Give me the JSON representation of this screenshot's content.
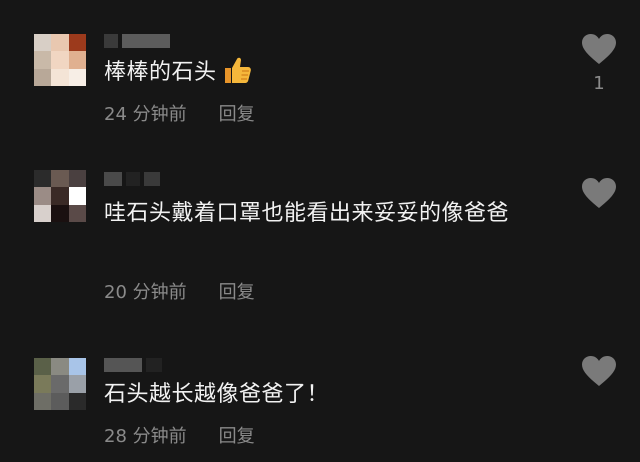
{
  "comments": [
    {
      "text": "棒棒的石头",
      "emoji": "thumbs-up-icon",
      "time": "24 分钟前",
      "reply_label": "回复",
      "likes": "1"
    },
    {
      "text": "哇石头戴着口罩也能看出来妥妥的像爸爸",
      "time": "20 分钟前",
      "reply_label": "回复"
    },
    {
      "text": "石头越长越像爸爸了！",
      "time": "28 分钟前",
      "reply_label": "回复"
    }
  ],
  "colors": {
    "background": "#161616",
    "text": "#f2f2f2",
    "muted": "#8a8a8a",
    "heart": "#7a7a7a",
    "thumbs": "#f5a623"
  }
}
